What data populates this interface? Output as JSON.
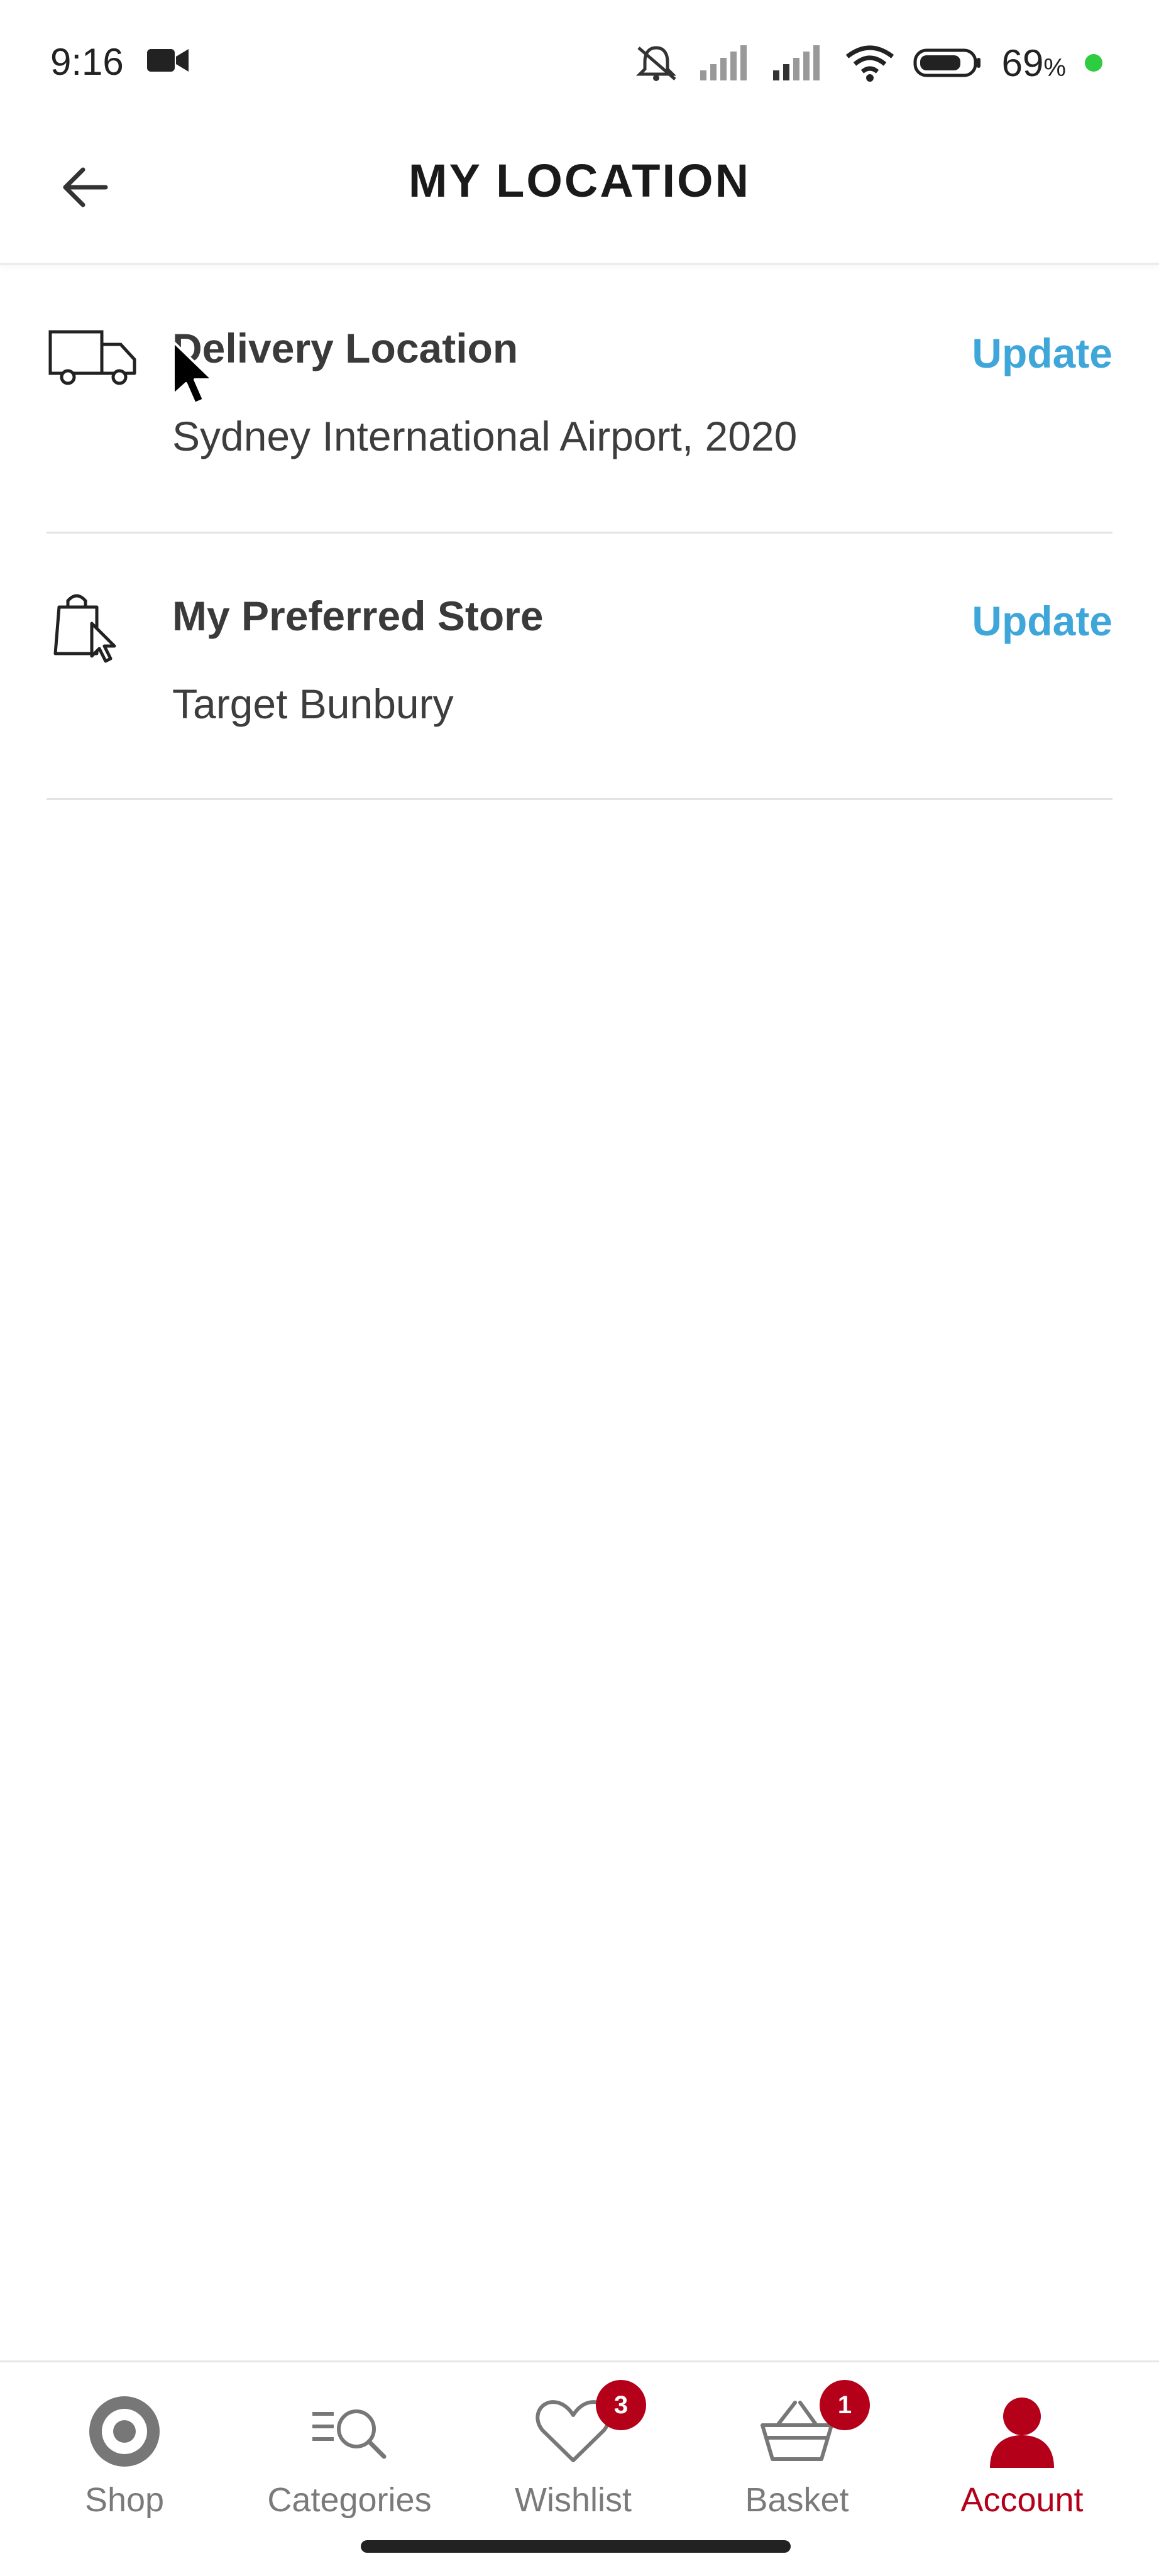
{
  "status_bar": {
    "time": "9:16",
    "battery_text": "69",
    "battery_unit": "%",
    "icons": [
      "video-camera-icon",
      "mute-bell-icon",
      "signal-icon",
      "signal-icon",
      "wifi-icon",
      "battery-icon",
      "charging-dot-icon"
    ]
  },
  "header": {
    "title": "MY LOCATION",
    "back_icon": "back-arrow-icon"
  },
  "rows": [
    {
      "icon": "delivery-truck-icon",
      "title": "Delivery Location",
      "subtitle": "Sydney International Airport, 2020",
      "action": "Update"
    },
    {
      "icon": "shopping-bag-cursor-icon",
      "title": "My Preferred Store",
      "subtitle": "Target Bunbury",
      "action": "Update"
    }
  ],
  "bottom_nav": {
    "items": [
      {
        "label": "Shop",
        "icon": "target-logo-icon",
        "active": false
      },
      {
        "label": "Categories",
        "icon": "categories-search-icon",
        "active": false
      },
      {
        "label": "Wishlist",
        "icon": "heart-icon",
        "active": false,
        "badge": "3"
      },
      {
        "label": "Basket",
        "icon": "basket-icon",
        "active": false,
        "badge": "1"
      },
      {
        "label": "Account",
        "icon": "person-icon",
        "active": true
      }
    ]
  },
  "colors": {
    "accent_link": "#3ea6d8",
    "brand_red": "#b5001a",
    "inactive_nav": "#7a7a7a"
  }
}
